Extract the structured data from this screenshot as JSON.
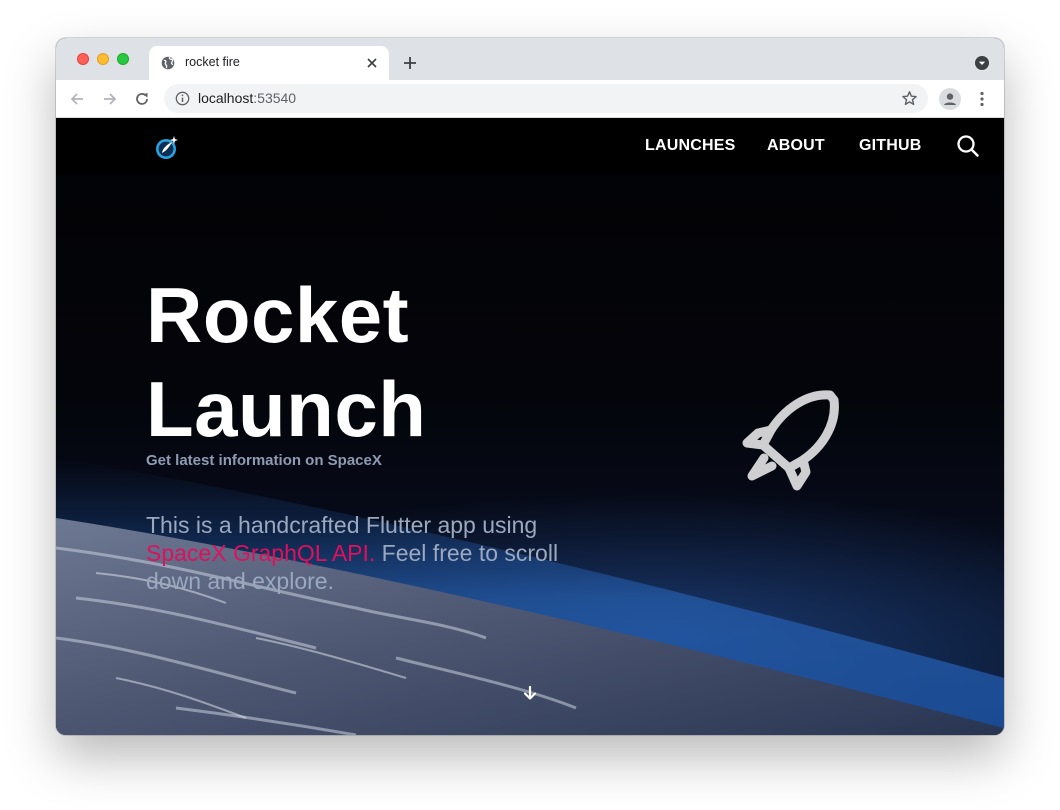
{
  "browser": {
    "tab_title": "rocket fire",
    "url_host": "localhost",
    "url_port": ":53540"
  },
  "navbar": {
    "links": [
      {
        "label": "LAUNCHES"
      },
      {
        "label": "ABOUT"
      },
      {
        "label": "GITHUB"
      }
    ]
  },
  "hero": {
    "title_line1": "Rocket",
    "title_line2": "Launch",
    "subtitle": "Get latest information on SpaceX",
    "description_before": "This is a handcrafted Flutter app using ",
    "api_link": "SpaceX GraphQL API.",
    "description_after": " Feel free to scroll down and explore."
  },
  "colors": {
    "accent": "#e0105d",
    "navbar_bg": "#000000",
    "text_muted": "#9aa8c0"
  },
  "icons": [
    "globe-icon",
    "close-icon",
    "plus-icon",
    "chevron-down-icon",
    "back-arrow-icon",
    "forward-arrow-icon",
    "reload-icon",
    "info-icon",
    "star-icon",
    "profile-icon",
    "more-vert-icon",
    "logo-icon",
    "search-icon",
    "rocket-icon",
    "arrow-down-icon"
  ]
}
